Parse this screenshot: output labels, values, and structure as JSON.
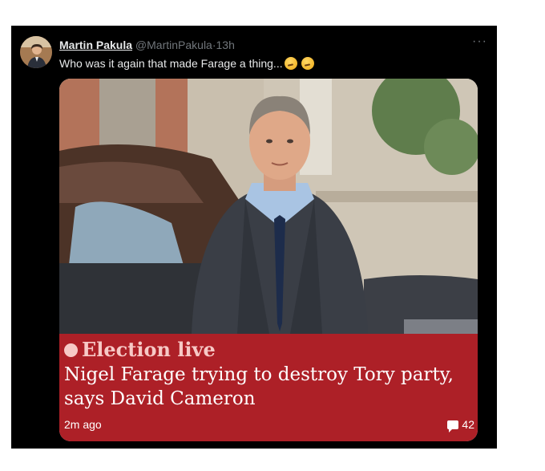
{
  "tweet": {
    "author": {
      "display_name": "Martin Pakula",
      "handle": "@MartinPakula",
      "separator": "·",
      "time": "13h",
      "avatar_icon": "profile-photo"
    },
    "more_label": "···",
    "text": "Who was it again that made Farage a thing...",
    "emoji": [
      "thinking-face-emoji",
      "thinking-face-emoji"
    ],
    "card": {
      "image": "photo-of-man-in-suit-walking-on-street",
      "kicker": "Election live",
      "headline": "Nigel Farage trying to destroy Tory party, says David Cameron",
      "time": "2m ago",
      "comment_count": "42",
      "comment_icon": "comment-bubble-icon"
    }
  },
  "colors": {
    "tweet_background": "#000000",
    "primary_text": "#e7e9ea",
    "secondary_text": "#71767b",
    "banner_red": "#ad2027",
    "kicker_pink": "#f7c9c6"
  }
}
